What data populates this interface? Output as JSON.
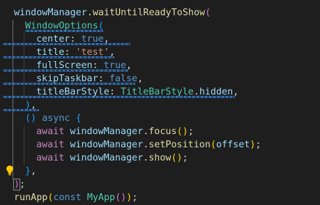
{
  "code": {
    "l1_fn_obj": "windowManager",
    "l1_dot": ".",
    "l1_method": "waitUntilReadyToShow",
    "l1_paren": "(",
    "l2_class": "WindowOptions",
    "l2_paren": "(",
    "l3_key": "center",
    "l3_colon": ": ",
    "l3_val": "true",
    "l3_comma": ",",
    "l4_key": "title",
    "l4_colon": ": ",
    "l4_val": "'test'",
    "l4_comma": ",",
    "l5_key": "fullScreen",
    "l5_colon": ": ",
    "l5_val": "true",
    "l5_comma": ",",
    "l6_key": "skipTaskbar",
    "l6_colon": ": ",
    "l6_val": "false",
    "l6_comma": ",",
    "l7_key": "titleBarStyle",
    "l7_colon": ": ",
    "l7_class": "TitleBarStyle",
    "l7_dot": ".",
    "l7_member": "hidden",
    "l7_comma": ",",
    "l8_close": ")",
    "l8_comma": ",",
    "l9_parens": "()",
    "l9_async": "async",
    "l9_brace": "{",
    "l10_await": "await",
    "l10_obj": "windowManager",
    "l10_dot": ".",
    "l10_method": "focus",
    "l10_call": "()",
    "l10_semi": ";",
    "l11_await": "await",
    "l11_obj": "windowManager",
    "l11_dot": ".",
    "l11_method": "setPosition",
    "l11_open": "(",
    "l11_arg": "offset",
    "l11_close": ")",
    "l11_semi": ";",
    "l12_await": "await",
    "l12_obj": "windowManager",
    "l12_dot": ".",
    "l12_method": "show",
    "l12_call": "()",
    "l12_semi": ";",
    "l13_brace": "}",
    "l13_comma": ",",
    "l14_close": ")",
    "l14_semi": ";",
    "l15_fn": "runApp",
    "l15_open": "(",
    "l15_const": "const",
    "l15_class": "MyApp",
    "l15_call": "()",
    "l15_close": ")",
    "l15_semi": ";"
  },
  "colors": {
    "background": "#1e1e1e",
    "function": "#dcdcaa",
    "variable": "#9cdcfe",
    "class": "#4ec9b0",
    "keyword": "#569cd6",
    "control": "#c586c0",
    "string": "#ce9178",
    "bracket_gold": "#ffd700",
    "bracket_purple": "#da70d6",
    "bracket_blue": "#179fff",
    "squiggle": "#3794ff",
    "lightbulb": "#ffcc00"
  },
  "icons": {
    "gutter_action": "lightbulb-icon"
  }
}
